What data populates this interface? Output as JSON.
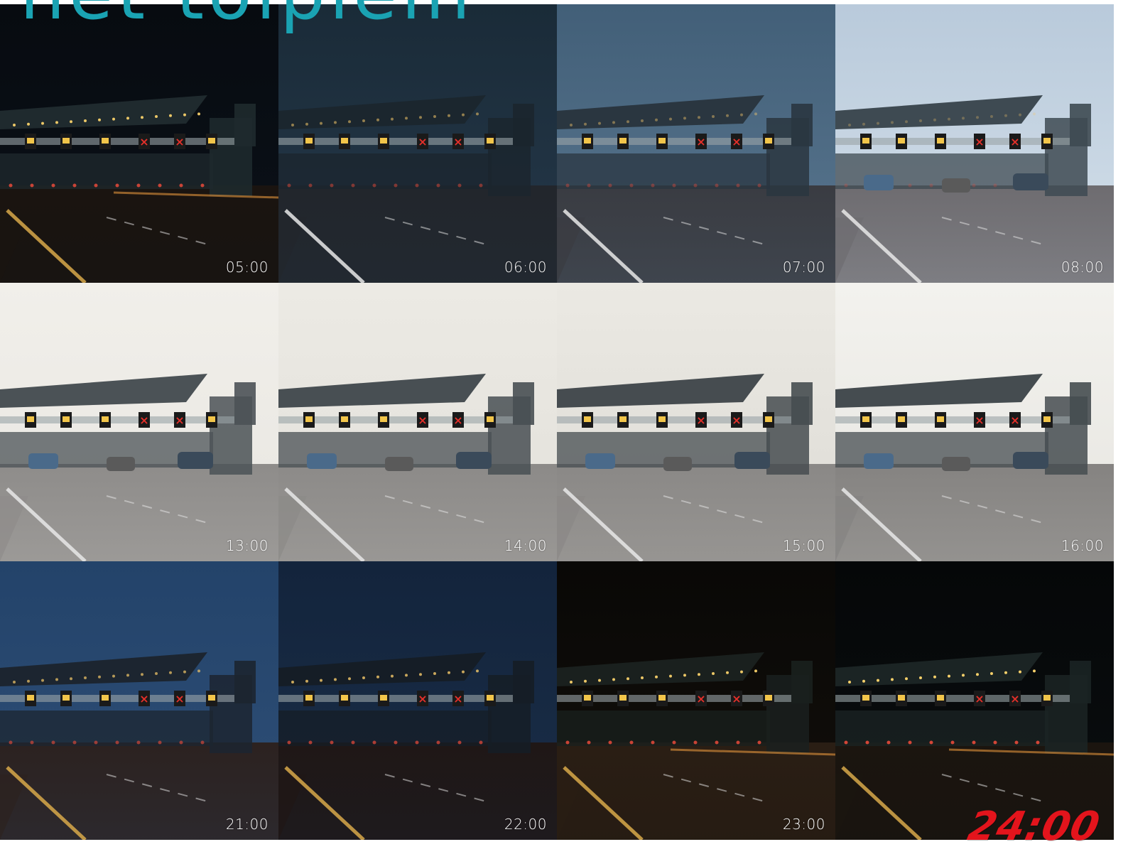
{
  "title": "het tolplein",
  "final_label": "24:00",
  "tiles": [
    {
      "time": "05:00",
      "sky": "#070b10",
      "skyLow": "#0b1119",
      "road": "#1a1410",
      "canopy": "#1f2a2e",
      "light": 0.95,
      "lights": "#f7d06a"
    },
    {
      "time": "06:00",
      "sky": "#1a2b38",
      "skyLow": "#25384a",
      "road": "#22262c",
      "canopy": "#1b262e",
      "light": 0.55,
      "lights": "#f5c86a"
    },
    {
      "time": "07:00",
      "sky": "#425f78",
      "skyLow": "#5a7790",
      "road": "#3a3c42",
      "canopy": "#2a3640",
      "light": 0.45,
      "lights": "#f2c56a"
    },
    {
      "time": "08:00",
      "sky": "#b9cadb",
      "skyLow": "#d4e0ea",
      "road": "#6e6c70",
      "canopy": "#3e4a52",
      "light": 0.3,
      "lights": "#f4c86a"
    },
    {
      "time": "13:00",
      "sky": "#f1efea",
      "skyLow": "#e8e6e1",
      "road": "#8e8c8a",
      "canopy": "#4b5256",
      "light": 0.0,
      "lights": "#f4c86a"
    },
    {
      "time": "14:00",
      "sky": "#eceae4",
      "skyLow": "#e2e0da",
      "road": "#8c8a88",
      "canopy": "#484f53",
      "light": 0.0,
      "lights": "#f4c86a"
    },
    {
      "time": "15:00",
      "sky": "#ebe9e3",
      "skyLow": "#dddbd5",
      "road": "#8a8886",
      "canopy": "#464c50",
      "light": 0.0,
      "lights": "#f4c86a"
    },
    {
      "time": "16:00",
      "sky": "#f3f2ee",
      "skyLow": "#e6e5e0",
      "road": "#858381",
      "canopy": "#454c50",
      "light": 0.05,
      "lights": "#f4c86a"
    },
    {
      "time": "21:00",
      "sky": "#23436a",
      "skyLow": "#2f4f77",
      "road": "#2c2220",
      "canopy": "#1c2530",
      "light": 0.7,
      "lights": "#f6cb6a"
    },
    {
      "time": "22:00",
      "sky": "#13243c",
      "skyLow": "#1a2e48",
      "road": "#1f1716",
      "canopy": "#151d26",
      "light": 0.8,
      "lights": "#f6cb6a"
    },
    {
      "time": "23:00",
      "sky": "#090806",
      "skyLow": "#120f0b",
      "road": "#2a1e14",
      "canopy": "#1a201e",
      "light": 0.95,
      "lights": "#f7d06a"
    },
    {
      "time": "",
      "sky": "#050708",
      "skyLow": "#0a0e10",
      "road": "#1b150f",
      "canopy": "#1b2424",
      "light": 1.0,
      "lights": "#f7d06a"
    }
  ]
}
